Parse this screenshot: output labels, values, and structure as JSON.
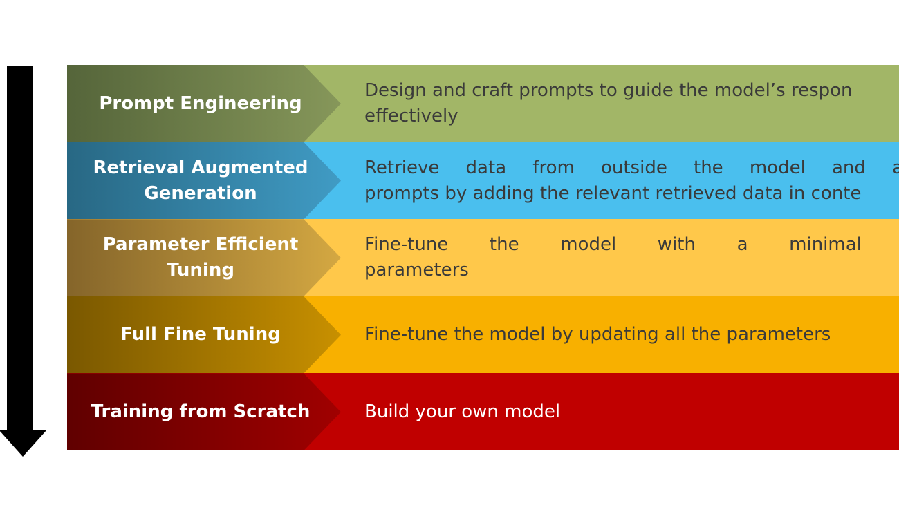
{
  "rows": [
    {
      "label": "Prompt Engineering",
      "lines": [
        "Design and craft prompts to guide the model’s respon",
        "effectively"
      ],
      "color": "#a2b667",
      "grad": [
        "#55653a",
        "#86975a"
      ]
    },
    {
      "label": "Retrieval Augmented Generation",
      "lines": [
        "Retrieve data from outside the model and augment",
        "prompts by adding the relevant retrieved data in conte"
      ],
      "color": "#4abfee",
      "grad": [
        "#286884",
        "#409bc4"
      ]
    },
    {
      "label": "Parameter Efficient Tuning",
      "lines": [
        "Fine-tune the model with a minimal number",
        "parameters"
      ],
      "color": "#ffc84a",
      "grad": [
        "#85652a",
        "#d4a842"
      ]
    },
    {
      "label": "Full Fine Tuning",
      "lines": [
        "Fine-tune the model by updating all the parameters"
      ],
      "color": "#f8b000",
      "grad": [
        "#7a5800",
        "#c89000"
      ]
    },
    {
      "label": "Training from Scratch",
      "lines": [
        "Build your own model"
      ],
      "color": "#c00000",
      "grad": [
        "#600000",
        "#a00000"
      ]
    }
  ],
  "arrow": {
    "direction": "down",
    "color": "#000000"
  }
}
